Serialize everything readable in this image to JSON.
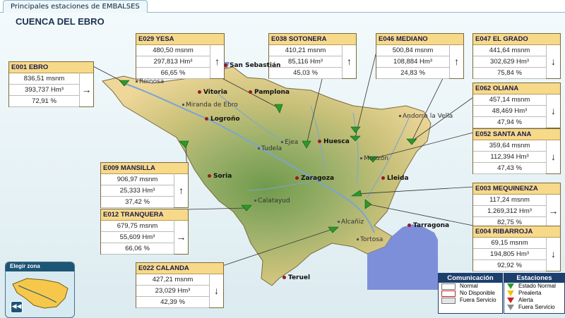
{
  "tab": "Principales estaciones de EMBALSES",
  "title": "CUENCA DEL EBRO",
  "stations": [
    {
      "code": "E001",
      "name": "EBRO",
      "level": "836,51 msnm",
      "volume": "393,737 Hm³",
      "percent": "72,91 %",
      "trend": "→"
    },
    {
      "code": "E029",
      "name": "YESA",
      "level": "480,50 msnm",
      "volume": "297,813 Hm³",
      "percent": "66,65 %",
      "trend": "↑"
    },
    {
      "code": "E038",
      "name": "SOTONERA",
      "level": "410,21 msnm",
      "volume": "85,116 Hm³",
      "percent": "45,03 %",
      "trend": "↑"
    },
    {
      "code": "E046",
      "name": "MEDIANO",
      "level": "500,84 msnm",
      "volume": "108,884 Hm³",
      "percent": "24,83 %",
      "trend": "↑"
    },
    {
      "code": "E047",
      "name": "EL GRADO",
      "level": "441,64 msnm",
      "volume": "302,629 Hm³",
      "percent": "75,84 %",
      "trend": "↓"
    },
    {
      "code": "E062",
      "name": "OLIANA",
      "level": "457,14 msnm",
      "volume": "48,469 Hm³",
      "percent": "47,94 %",
      "trend": "↓"
    },
    {
      "code": "E052",
      "name": "SANTA ANA",
      "level": "359,64 msnm",
      "volume": "112,394 Hm³",
      "percent": "47,43 %",
      "trend": "↓"
    },
    {
      "code": "E009",
      "name": "MANSILLA",
      "level": "906,97 msnm",
      "volume": "25,333 Hm³",
      "percent": "37,42 %",
      "trend": "↑"
    },
    {
      "code": "E012",
      "name": "TRANQUERA",
      "level": "679,75 msnm",
      "volume": "55,609 Hm³",
      "percent": "66,06 %",
      "trend": "→"
    },
    {
      "code": "E022",
      "name": "CALANDA",
      "level": "427,21 msnm",
      "volume": "23,029 Hm³",
      "percent": "42,39 %",
      "trend": "↓"
    },
    {
      "code": "E003",
      "name": "MEQUINENZA",
      "level": "117,24 msnm",
      "volume": "1.269,312 Hm³",
      "percent": "82,75 %",
      "trend": "→"
    },
    {
      "code": "E004",
      "name": "RIBARROJA",
      "level": "69,15 msnm",
      "volume": "194,805 Hm³",
      "percent": "92,92 %",
      "trend": "↓"
    }
  ],
  "cities": [
    "San Sebastián",
    "Vitoria",
    "Pamplona",
    "Logroño",
    "Soria",
    "Huesca",
    "Zaragoza",
    "Lleida",
    "Tarragona",
    "Teruel"
  ],
  "towns": [
    "Reinosa",
    "Miranda de Ebro",
    "Tudela",
    "Ejea",
    "Monzón",
    "Andorra la Vella",
    "Calatayud",
    "Alcañiz",
    "Tortosa"
  ],
  "choose_zone": {
    "title": "Elegir zona",
    "back_icon": "rewind-icon"
  },
  "legend_comm": {
    "title": "Comunicación",
    "items": [
      "Normal",
      "No Disponible",
      "Fuera Servicio"
    ]
  },
  "legend_station": {
    "title": "Estaciones",
    "items": [
      "Estado Normal",
      "Prealerta",
      "Alerta",
      "Fuera Servicio"
    ]
  },
  "colors": {
    "terrain_low": "#6f9a4c",
    "terrain_mid": "#c9c17a",
    "terrain_high": "#efd79a",
    "sea": "#7e8fda",
    "river": "#7ba4d4",
    "station_ok": "#2a9a2a"
  }
}
